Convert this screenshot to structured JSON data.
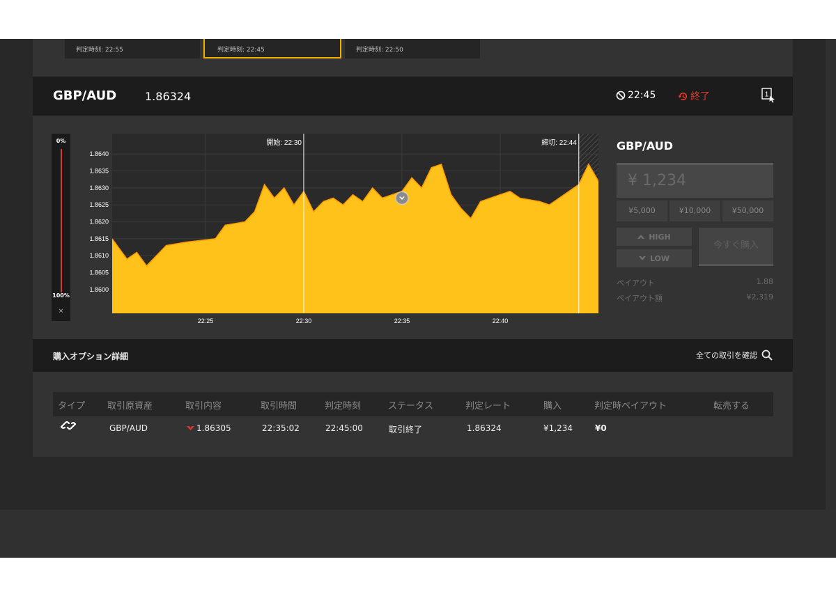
{
  "top_cards": [
    {
      "label": "判定時刻: 22:55",
      "selected": false
    },
    {
      "label": "判定時刻: 22:45",
      "selected": true
    },
    {
      "label": "判定時刻: 22:50",
      "selected": false
    }
  ],
  "header": {
    "pair": "GBP/AUD",
    "rate": "1.86324",
    "time": "22:45",
    "status": "終了",
    "status_color": "#e0392b"
  },
  "slider": {
    "top_label": "0%",
    "bottom_label": "100%",
    "close_label": "×"
  },
  "chart_data": {
    "type": "area",
    "y_ticks": [
      "1.8640",
      "1.8635",
      "1.8630",
      "1.8625",
      "1.8620",
      "1.8615",
      "1.8610",
      "1.8605",
      "1.8600"
    ],
    "x_ticks": [
      "22:25",
      "22:30",
      "22:35",
      "22:40"
    ],
    "ylim": [
      1.8593,
      1.8646
    ],
    "start_label": "開始: 22:30",
    "deadline_label": "締切: 22:44",
    "fill_color": "#ffc21a",
    "edge_color": "#ff9900",
    "x": [
      "22:20:15",
      "22:21:00",
      "22:21:30",
      "22:22:00",
      "22:23:00",
      "22:24:00",
      "22:25:30",
      "22:26:00",
      "22:27:00",
      "22:27:30",
      "22:28:00",
      "22:28:30",
      "22:29:00",
      "22:29:30",
      "22:30:00",
      "22:30:30",
      "22:31:00",
      "22:31:30",
      "22:32:00",
      "22:32:30",
      "22:33:00",
      "22:33:30",
      "22:34:00",
      "22:34:30",
      "22:35:00",
      "22:35:30",
      "22:36:00",
      "22:36:30",
      "22:37:00",
      "22:37:30",
      "22:38:00",
      "22:38:30",
      "22:39:00",
      "22:40:00",
      "22:40:30",
      "22:41:00",
      "22:42:00",
      "22:42:30",
      "22:43:00",
      "22:43:30",
      "22:44:00",
      "22:44:30",
      "22:45:00"
    ],
    "values": [
      1.8615,
      1.8609,
      1.8611,
      1.8607,
      1.8613,
      1.8614,
      1.8615,
      1.8619,
      1.862,
      1.8623,
      1.8631,
      1.8627,
      1.863,
      1.8625,
      1.8629,
      1.8623,
      1.8626,
      1.8627,
      1.8625,
      1.8628,
      1.8626,
      1.863,
      1.8627,
      1.8628,
      1.8629,
      1.8633,
      1.863,
      1.8636,
      1.8637,
      1.8628,
      1.8624,
      1.8621,
      1.8626,
      1.8628,
      1.8629,
      1.8627,
      1.8626,
      1.8625,
      1.8627,
      1.8629,
      1.8631,
      1.8637,
      1.8632
    ],
    "marker": {
      "x": "22:35:00",
      "y": 1.8627
    }
  },
  "panel": {
    "title": "GBP/AUD",
    "amount": "¥ 1,234",
    "amount_buttons": [
      "¥5,000",
      "¥10,000",
      "¥50,000"
    ],
    "high_label": "HIGH",
    "low_label": "LOW",
    "buy_now": "今すぐ購入",
    "payout_label": "ペイアウト",
    "payout_value": "1.88",
    "payout_amount_label": "ペイアウト額",
    "payout_amount_value": "¥2,319"
  },
  "details": {
    "title": "購入オプション詳細",
    "view_all": "全ての取引を確認"
  },
  "table": {
    "headers": [
      "タイプ",
      "取引原資産",
      "取引内容",
      "取引時間",
      "判定時刻",
      "ステータス",
      "判定レート",
      "購入",
      "判定時ペイアウト",
      "転売する"
    ],
    "row": {
      "asset": "GBP/AUD",
      "content": "1.86305",
      "trade_time": "22:35:02",
      "judgment_time": "22:45:00",
      "status": "取引終了",
      "judgment_rate": "1.86324",
      "purchase": "¥1,234",
      "payout": "¥0"
    }
  }
}
